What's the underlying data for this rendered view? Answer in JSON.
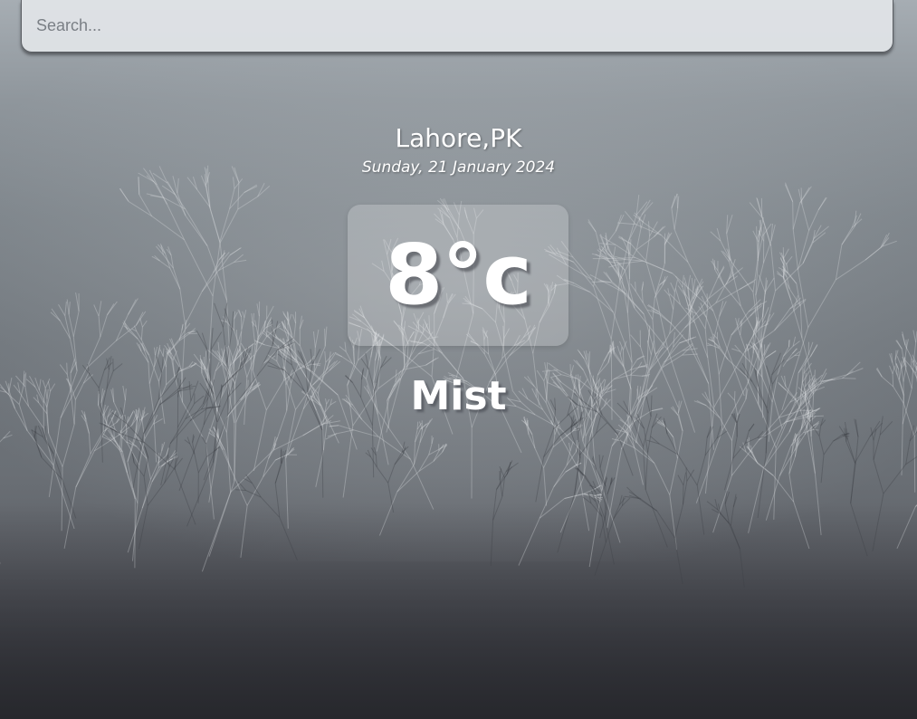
{
  "search": {
    "placeholder": "Search...",
    "value": ""
  },
  "weather": {
    "location": "Lahore,PK",
    "date": "Sunday, 21 January 2024",
    "temperature": "8°c",
    "condition": "Mist"
  },
  "background": {
    "scene": "frosted-bushes",
    "colors": {
      "sky": "#a6adb3",
      "ground": "#3a3b40"
    }
  }
}
